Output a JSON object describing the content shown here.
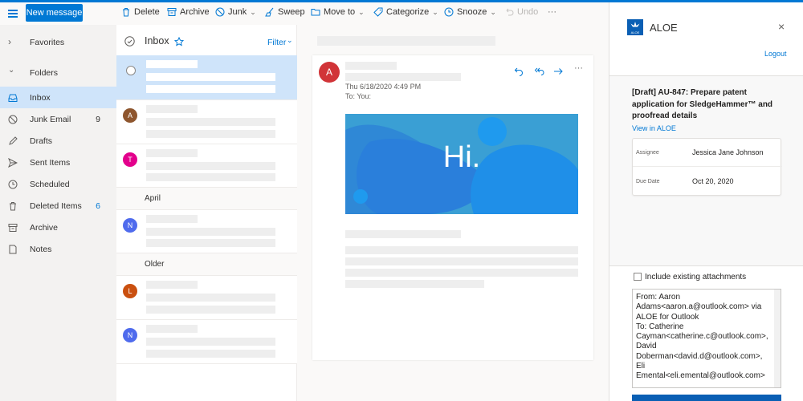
{
  "toolbar": {
    "new_message": "New message",
    "delete": "Delete",
    "archive": "Archive",
    "junk": "Junk",
    "sweep": "Sweep",
    "move_to": "Move to",
    "categorize": "Categorize",
    "snooze": "Snooze",
    "undo": "Undo",
    "more": "···"
  },
  "nav": {
    "favorites": "Favorites",
    "folders": "Folders",
    "items": [
      {
        "label": "Inbox",
        "count": "",
        "icon": "inbox-icon"
      },
      {
        "label": "Junk Email",
        "count": "9",
        "icon": "junk-icon"
      },
      {
        "label": "Drafts",
        "count": "",
        "icon": "pencil-icon"
      },
      {
        "label": "Sent Items",
        "count": "",
        "icon": "send-icon"
      },
      {
        "label": "Scheduled",
        "count": "",
        "icon": "clock-icon"
      },
      {
        "label": "Deleted Items",
        "count": "6",
        "icon": "trash-icon"
      },
      {
        "label": "Archive",
        "count": "",
        "icon": "archive-icon"
      },
      {
        "label": "Notes",
        "count": "",
        "icon": "note-icon"
      }
    ]
  },
  "list": {
    "title": "Inbox",
    "filter": "Filter",
    "section_april": "April",
    "section_older": "Older",
    "avatars": [
      {
        "initial": "A",
        "color": "#8e562e"
      },
      {
        "initial": "T",
        "color": "#e3008c"
      },
      {
        "initial": "N",
        "color": "#4f6bed"
      },
      {
        "initial": "L",
        "color": "#ca5010"
      },
      {
        "initial": "N",
        "color": "#4f6bed"
      }
    ]
  },
  "reading": {
    "sender_initial": "A",
    "sender_color": "#d13438",
    "date": "Thu 6/18/2020 4:49 PM",
    "to": "To:  You:",
    "hero_text": "Hi."
  },
  "aloe": {
    "brand": "ALOE",
    "logo_text": "ALOE",
    "logout": "Logout",
    "task_title": "[Draft] AU-847: Prepare patent application for SledgeHammer™ and proofread details",
    "view_link": "View in ALOE",
    "assignee_label": "Assignee",
    "assignee_value": "Jessica Jane Johnson",
    "due_label": "Due Date",
    "due_value": "Oct 20, 2020",
    "include_label": "Include existing attachments",
    "from_text": "From: Aaron Adams<aaron.a@outlook.com> via ALOE for Outlook\nTo: Catherine Cayman<catherine.c@outlook.com>, David Doberman<david.d@outlook.com>, Eli Emental<eli.emental@outlook.com>"
  },
  "colors": {
    "accent": "#0078d4",
    "selected": "#cfe4fa"
  }
}
